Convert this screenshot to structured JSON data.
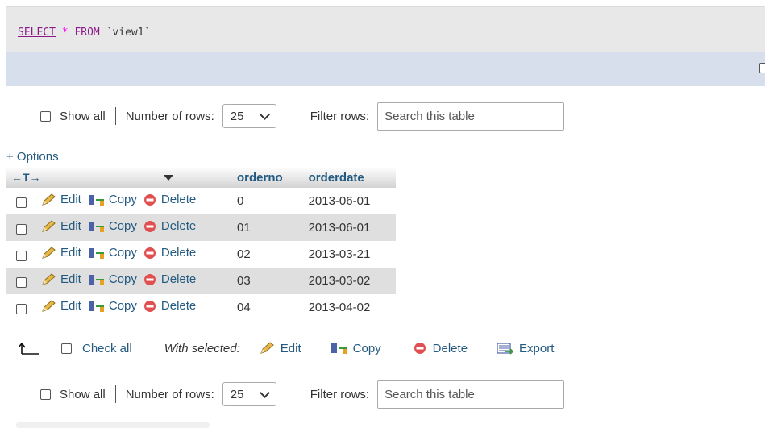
{
  "query": {
    "select": "SELECT",
    "star": "*",
    "from": "FROM",
    "table": "`view1`"
  },
  "nav_top": {
    "show_all": "Show all",
    "rows_label": "Number of rows:",
    "rows_value": "25",
    "filter_label": "Filter rows:",
    "search_placeholder": "Search this table"
  },
  "nav_bottom": {
    "show_all": "Show all",
    "rows_label": "Number of rows:",
    "rows_value": "25",
    "filter_label": "Filter rows:",
    "search_placeholder": "Search this table"
  },
  "options_label": "+ Options",
  "table": {
    "col_arrows": "←T→",
    "columns": [
      "orderno",
      "orderdate"
    ],
    "action_labels": {
      "edit": "Edit",
      "copy": "Copy",
      "delete": "Delete"
    },
    "rows": [
      {
        "orderno": "0",
        "orderdate": "2013-06-01"
      },
      {
        "orderno": "01",
        "orderdate": "2013-06-01"
      },
      {
        "orderno": "02",
        "orderdate": "2013-03-21"
      },
      {
        "orderno": "03",
        "orderdate": "2013-03-02"
      },
      {
        "orderno": "04",
        "orderdate": "2013-04-02"
      }
    ]
  },
  "bulk": {
    "check_all": "Check all",
    "with_selected": "With selected:",
    "edit": "Edit",
    "copy": "Copy",
    "delete": "Delete",
    "export": "Export"
  },
  "icons": [
    "pencil-icon",
    "copy-icon",
    "delete-icon",
    "export-icon",
    "sort-desc-icon",
    "up-arrow-icon"
  ]
}
